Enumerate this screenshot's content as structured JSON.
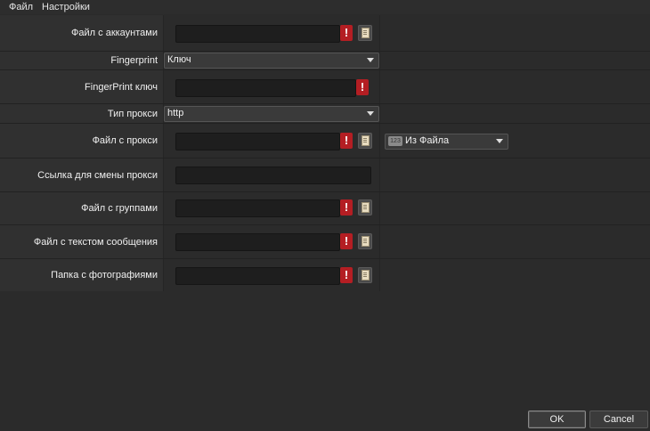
{
  "menu": {
    "file": "Файл",
    "settings": "Настройки"
  },
  "form": {
    "accounts_file": {
      "label": "Файл с аккаунтами",
      "value": ""
    },
    "fingerprint": {
      "label": "Fingerprint",
      "selected": "Ключ"
    },
    "fingerprint_key": {
      "label": "FingerPrint ключ",
      "value": ""
    },
    "proxy_type": {
      "label": "Тип прокси",
      "selected": "http"
    },
    "proxy_file": {
      "label": "Файл с прокси",
      "value": "",
      "source": {
        "badge": "123",
        "selected": "Из Файла"
      }
    },
    "proxy_change_link": {
      "label": "Ссылка для смены прокси",
      "value": ""
    },
    "groups_file": {
      "label": "Файл с группами",
      "value": ""
    },
    "message_file": {
      "label": "Файл с текстом сообщения",
      "value": ""
    },
    "photos_folder": {
      "label": "Папка с фотографиями",
      "value": ""
    }
  },
  "icons": {
    "warning": "!",
    "browse": "document-icon"
  },
  "buttons": {
    "ok": "OK",
    "cancel": "Cancel"
  },
  "colors": {
    "warning": "#b41e23",
    "background": "#2b2b2b"
  }
}
